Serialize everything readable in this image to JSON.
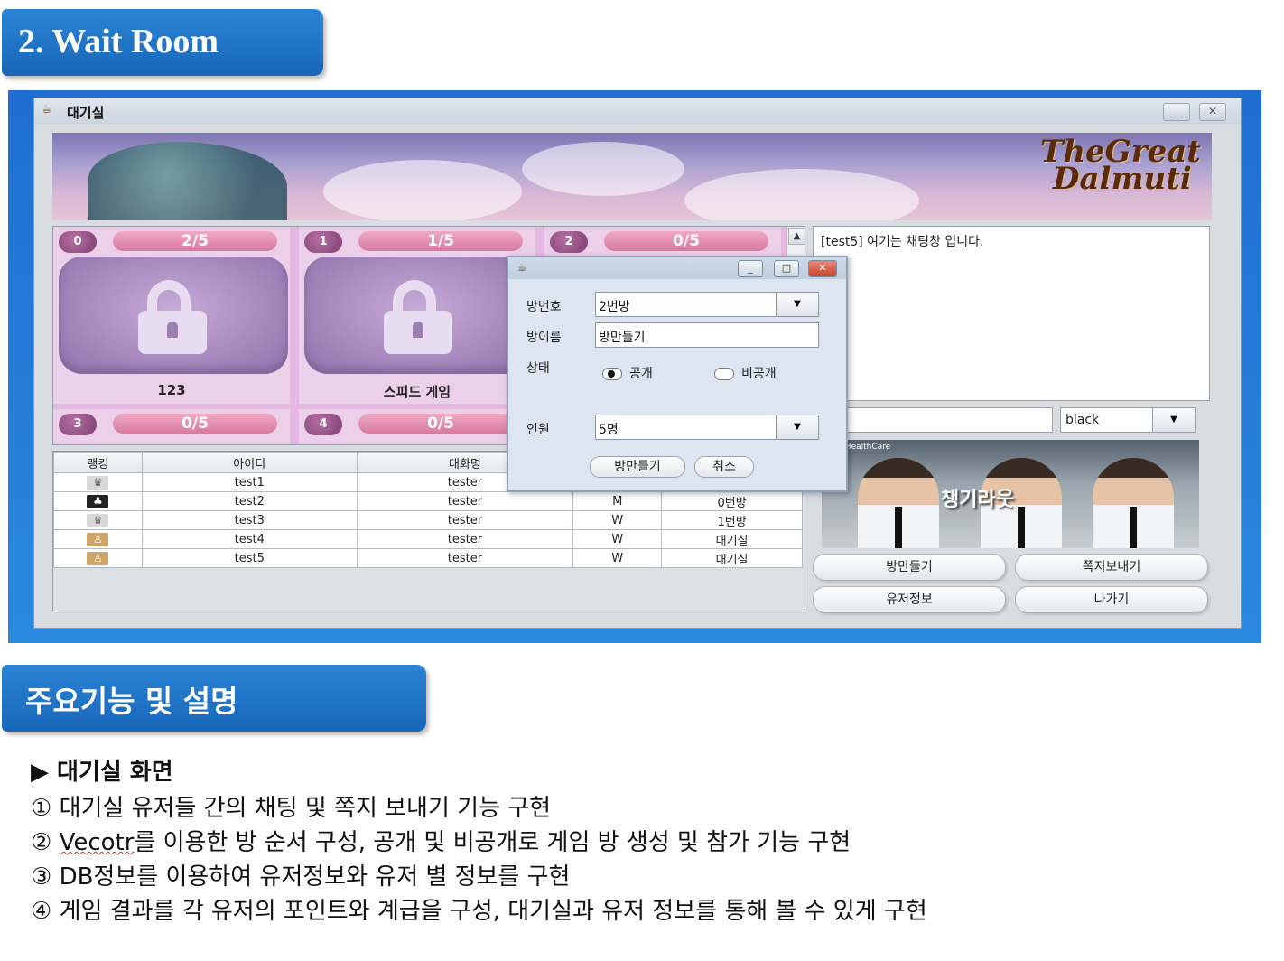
{
  "section1_title": "2. Wait Room",
  "section2_title": "주요기능 및 설명",
  "window": {
    "title": "대기실",
    "minimize": "_",
    "close": "✕",
    "logo_line1": "TheGreat",
    "logo_line2": "Dalmuti"
  },
  "rooms": [
    {
      "num": "0",
      "count": "2/5",
      "name": "123"
    },
    {
      "num": "1",
      "count": "1/5",
      "name": "스피드 게임"
    },
    {
      "num": "2",
      "count": "0/5",
      "name": ""
    },
    {
      "num": "3",
      "count": "0/5",
      "name": ""
    },
    {
      "num": "4",
      "count": "0/5",
      "name": ""
    }
  ],
  "user_table": {
    "headers": [
      "랭킹",
      "아이디",
      "대화명",
      "성별",
      "위치"
    ],
    "rows": [
      {
        "rank_icon": "crown-icon",
        "id": "test1",
        "nick": "tester",
        "gender": "",
        "location": ""
      },
      {
        "rank_icon": "black-rank-icon",
        "id": "test2",
        "nick": "tester",
        "gender": "M",
        "location": "0번방"
      },
      {
        "rank_icon": "crown-icon",
        "id": "test3",
        "nick": "tester",
        "gender": "W",
        "location": "1번방"
      },
      {
        "rank_icon": "peasant-icon",
        "id": "test4",
        "nick": "tester",
        "gender": "W",
        "location": "대기실"
      },
      {
        "rank_icon": "peasant-icon",
        "id": "test5",
        "nick": "tester",
        "gender": "W",
        "location": "대기실"
      }
    ]
  },
  "chat": {
    "message": "[test5] 여기는 채팅창 입니다.",
    "input_value": "",
    "color_select": "black"
  },
  "ad": {
    "brand": "CJ HealthCare",
    "text": "챙기라웃"
  },
  "buttons": {
    "make_room": "방만들기",
    "send_note": "쪽지보내기",
    "user_info": "유저정보",
    "exit": "나가기"
  },
  "dialog": {
    "room_number_label": "방번호",
    "room_number_value": "2번방",
    "room_name_label": "방이름",
    "room_name_value": "방만들기",
    "status_label": "상태",
    "public_label": "공개",
    "private_label": "비공개",
    "selected_status": "공개",
    "people_label": "인원",
    "people_value": "5명",
    "ok_button": "방만들기",
    "cancel_button": "취소"
  },
  "description": {
    "heading": "▶ 대기실 화면",
    "lines": [
      {
        "marker": "①",
        "text": "대기실 유저들 간의 채팅 및 쪽지 보내기 기능 구현"
      },
      {
        "marker": "②",
        "word": "Vecotr",
        "text": "를 이용한 방 순서 구성, 공개 및 비공개로 게임 방 생성 및 참가 기능 구현"
      },
      {
        "marker": "③",
        "text": "DB정보를 이용하여 유저정보와 유저 별 정보를 구현"
      },
      {
        "marker": "④",
        "text": "게임 결과를 각 유저의 포인트와 계급을 구성, 대기실과 유저 정보를 통해 볼 수 있게 구현"
      }
    ]
  }
}
